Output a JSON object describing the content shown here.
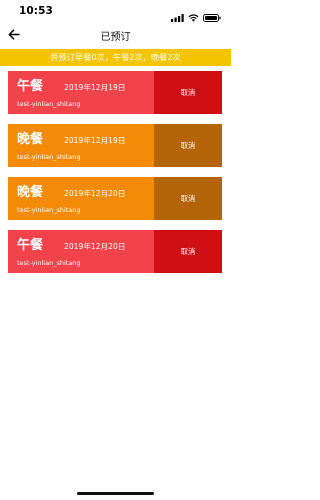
{
  "status_bar": {
    "time": "10:53",
    "signal_icon": "signal-bars-icon",
    "wifi_icon": "wifi-icon",
    "battery_icon": "battery-icon"
  },
  "header": {
    "title": "已预订",
    "back_icon": "arrow-left-icon"
  },
  "summary": {
    "text": "共预订早餐0次，午餐2次，晚餐2次"
  },
  "colors": {
    "summary_bg": "#f5c400",
    "lunch_body": "#f2434b",
    "lunch_cancel": "#cf0f14",
    "dinner_body": "#f48b08",
    "dinner_cancel": "#b46509"
  },
  "reservations": [
    {
      "meal": "午餐",
      "date": "2019年12月19日",
      "location": "test-yinlian_shitang",
      "cancel_label": "取消"
    },
    {
      "meal": "晚餐",
      "date": "2019年12月19日",
      "location": "test-yinlian_shitang",
      "cancel_label": "取消"
    },
    {
      "meal": "晚餐",
      "date": "2019年12月20日",
      "location": "test-yinlian_shitang",
      "cancel_label": "取消"
    },
    {
      "meal": "午餐",
      "date": "2019年12月20日",
      "location": "test-yinlian_shitang",
      "cancel_label": "取消"
    }
  ]
}
